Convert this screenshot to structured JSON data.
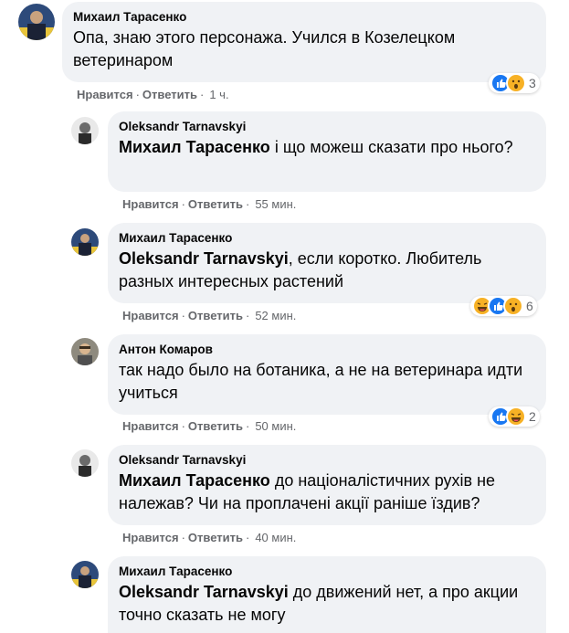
{
  "comments": [
    {
      "author": "Михаил Тарасенко",
      "mention": "",
      "text": "Опа, знаю этого персонажа. Учился в Козелецком ветеринаром",
      "like": "Нравится",
      "reply": "Ответить",
      "time": "1 ч.",
      "reactions": [
        "like-reaction-icon",
        "wow-reaction-icon"
      ],
      "reaction_count": "3"
    },
    {
      "author": "Oleksandr Tarnavskyi",
      "mention": "Михаил Тарасенко",
      "text": " і що можеш сказати про нього?",
      "like": "Нравится",
      "reply": "Ответить",
      "time": "55 мин.",
      "reactions": [],
      "reaction_count": ""
    },
    {
      "author": "Михаил Тарасенко",
      "mention": "Oleksandr Tarnavskyi",
      "text": ", если коротко. Любитель разных интересных растений",
      "like": "Нравится",
      "reply": "Ответить",
      "time": "52 мин.",
      "reactions": [
        "haha-reaction-icon",
        "like-reaction-icon",
        "wow-reaction-icon"
      ],
      "reaction_count": "6"
    },
    {
      "author": "Антон Комаров",
      "mention": "",
      "text": "так надо было на ботаника, а не на ветеринара идти учиться",
      "like": "Нравится",
      "reply": "Ответить",
      "time": "50 мин.",
      "reactions": [
        "like-reaction-icon",
        "haha-reaction-icon"
      ],
      "reaction_count": "2"
    },
    {
      "author": "Oleksandr Tarnavskyi",
      "mention": "Михаил Тарасенко",
      "text": " до націоналістичних рухів не належав? Чи на проплачені акції раніше їздив?",
      "like": "Нравится",
      "reply": "Ответить",
      "time": "40 мин.",
      "reactions": [],
      "reaction_count": ""
    },
    {
      "author": "Михаил Тарасенко",
      "mention": "Oleksandr Tarnavskyi",
      "text": " до движений нет, а про акции точно сказать не могу",
      "like": "",
      "reply": "",
      "time": "",
      "reactions": [],
      "reaction_count": ""
    }
  ],
  "colors": {
    "bubble": "#f0f2f5",
    "like_blue": "#1877f2",
    "emoji_yellow": "#f7b125",
    "meta_gray": "#65676b"
  }
}
